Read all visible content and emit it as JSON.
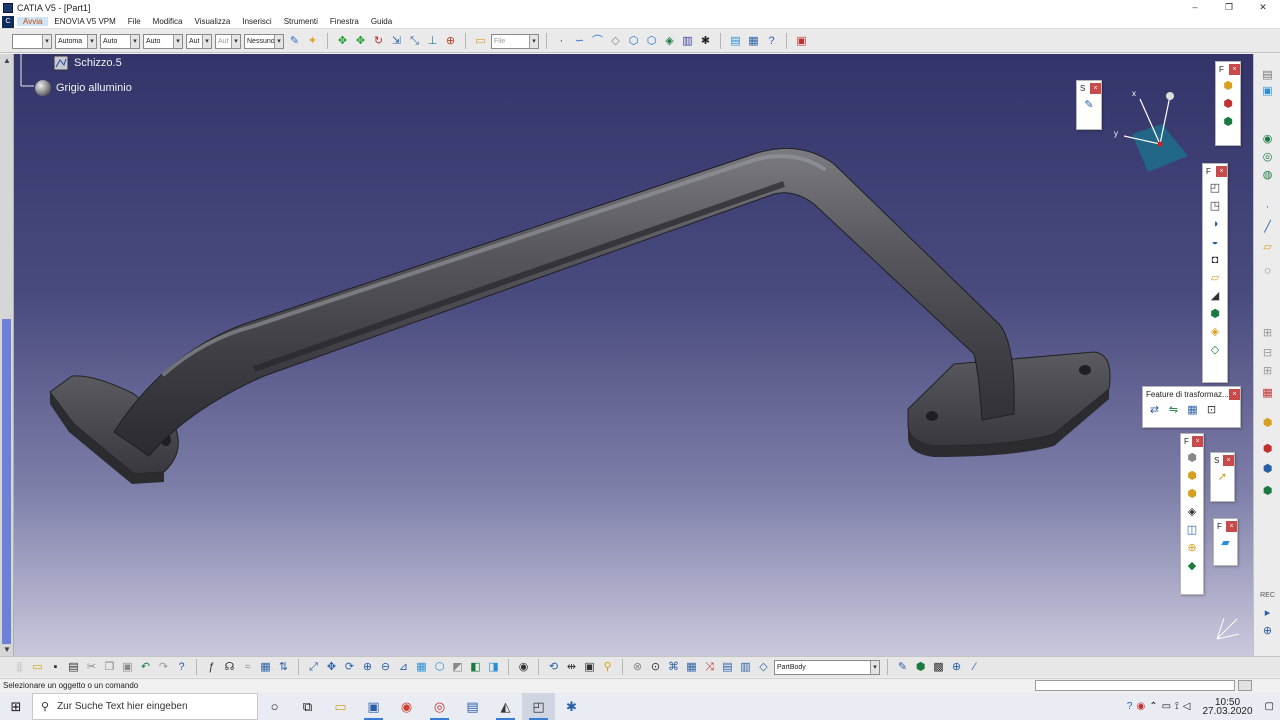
{
  "window": {
    "title": "CATIA V5 - [Part1]",
    "controls": [
      "–",
      "❐",
      "✕"
    ]
  },
  "menu": {
    "items": [
      "Avvia",
      "ENOVIA V5 VPM",
      "File",
      "Modifica",
      "Visualizza",
      "Inserisci",
      "Strumenti",
      "Finestra",
      "Guida"
    ]
  },
  "toolbar_top": {
    "combos": [
      "",
      "Automa",
      "Auto",
      "Auto",
      "Aut",
      "Aut",
      "Nessuno"
    ],
    "file_combo": "File"
  },
  "tree": {
    "nodes": [
      {
        "label": "Schizzo.5",
        "icon": "sketch-icon"
      },
      {
        "label": "Grigio alluminio",
        "icon": "material-sphere-icon"
      }
    ]
  },
  "compass": {
    "x_label": "x",
    "y_label": "y"
  },
  "float_toolbars": {
    "transform_title": "Feature di trasformaz...",
    "s1_title": "S",
    "s2_title": "S",
    "f1_title": "F",
    "f2_title": "F",
    "f3_title": "F",
    "f4_title": "F",
    "close": "×"
  },
  "bottom_toolbar": {
    "body_combo": "PartBody"
  },
  "status": {
    "message": "Selezionare un oggetto o un comando"
  },
  "taskbar": {
    "search_placeholder": "Zur Suche Text hier eingeben",
    "time": "10:50",
    "date": "27.03.2020"
  },
  "colors": {
    "viewport_top": "#33356a",
    "viewport_bottom": "#c9c9dd",
    "part_metal": "#4a4a4f",
    "active_menu": "#cfe4f7",
    "close_red": "#c94a4a"
  }
}
